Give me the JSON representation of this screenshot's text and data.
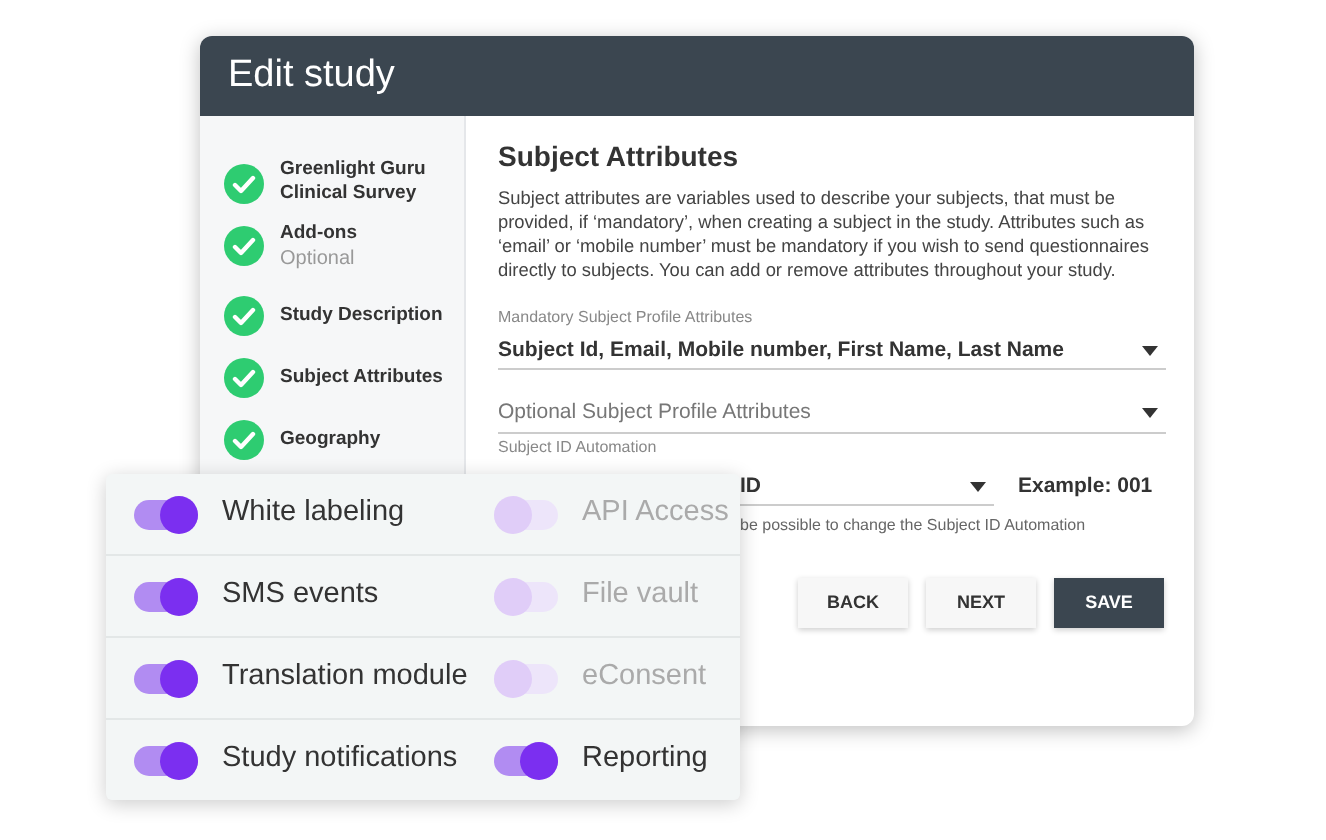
{
  "window": {
    "title": "Edit study"
  },
  "steps": [
    {
      "label": "Greenlight Guru Clinical Survey",
      "done": true
    },
    {
      "label": "Add-ons",
      "sublabel": "Optional",
      "done": true
    },
    {
      "label": "Study Description",
      "done": true
    },
    {
      "label": "Subject Attributes",
      "done": true
    },
    {
      "label": "Geography",
      "done": true
    }
  ],
  "content": {
    "heading": "Subject Attributes",
    "description": "Subject attributes are variables used to describe your subjects, that must be provided, if ‘mandatory’, when creating a subject in the study. Attributes such as ‘email’ or ‘mobile number’ must be mandatory if you wish to send questionnaires directly to subjects. You can add or remove attributes throughout your study.",
    "mandatory": {
      "label": "Mandatory Subject Profile Attributes",
      "value": "Subject Id, Email, Mobile number, First Name, Last Name"
    },
    "optional": {
      "placeholder": "Optional Subject Profile Attributes"
    },
    "automation": {
      "label": "Subject ID Automation",
      "value": "ID",
      "example": "Example: 001",
      "hint": "be possible to change the Subject ID Automation"
    }
  },
  "buttons": [
    {
      "label": "BACK",
      "kind": "secondary"
    },
    {
      "label": "NEXT",
      "kind": "secondary"
    },
    {
      "label": "SAVE",
      "kind": "primary"
    }
  ],
  "features": [
    {
      "label": "White labeling",
      "on": true
    },
    {
      "label": "API Access",
      "on": false
    },
    {
      "label": "SMS events",
      "on": true
    },
    {
      "label": "File vault",
      "on": false
    },
    {
      "label": "Translation module",
      "on": true
    },
    {
      "label": "eConsent",
      "on": false
    },
    {
      "label": "Study notifications",
      "on": true
    },
    {
      "label": "Reporting",
      "on": true
    }
  ]
}
